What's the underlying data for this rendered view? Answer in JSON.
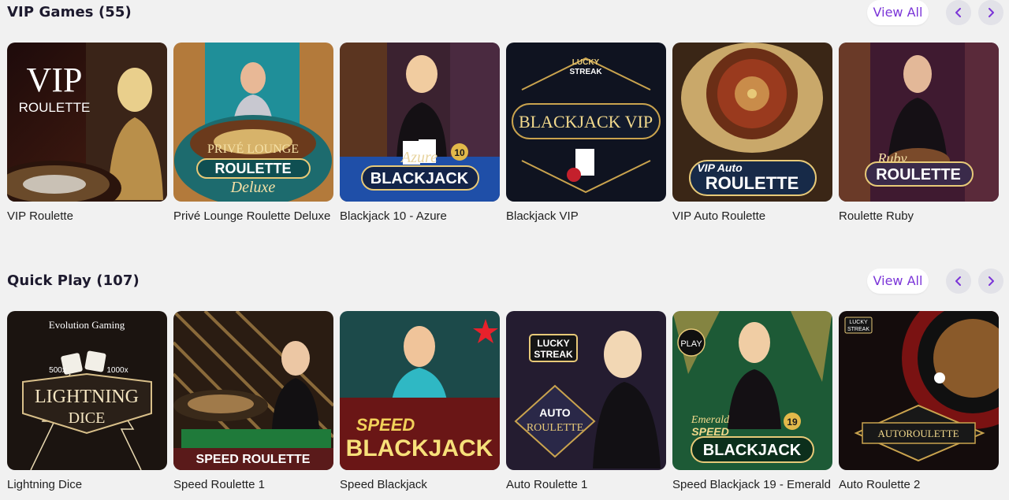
{
  "vip": {
    "title": "VIP Games (55)",
    "view_all": "View All",
    "games": [
      {
        "name": "VIP Roulette",
        "art": [
          "VIP",
          "ROULETTE"
        ]
      },
      {
        "name": "Privé Lounge Roulette Deluxe",
        "art": [
          "PRIVÉ LOUNGE",
          "ROULETTE",
          "Deluxe"
        ]
      },
      {
        "name": "Blackjack 10 - Azure",
        "art": [
          "Azure",
          "BLACKJACK",
          "10"
        ]
      },
      {
        "name": "Blackjack VIP",
        "art": [
          "LUCKY",
          "STREAK",
          "BLACKJACK VIP"
        ]
      },
      {
        "name": "VIP Auto Roulette",
        "art": [
          "VIP Auto",
          "ROULETTE"
        ]
      },
      {
        "name": "Roulette Ruby",
        "art": [
          "Ruby",
          "ROULETTE"
        ]
      }
    ]
  },
  "quick": {
    "title": "Quick Play (107)",
    "view_all": "View All",
    "games": [
      {
        "name": "Lightning Dice",
        "art": [
          "Evolution Gaming",
          "LIGHTNING",
          "DICE",
          "500x",
          "1000x"
        ]
      },
      {
        "name": "Speed Roulette 1",
        "art": [
          "SPEED ROULETTE"
        ]
      },
      {
        "name": "Speed Blackjack",
        "art": [
          "SPEED",
          "BLACKJACK"
        ]
      },
      {
        "name": "Auto Roulette 1",
        "art": [
          "LUCKY",
          "STREAK",
          "AUTO",
          "ROULETTE"
        ]
      },
      {
        "name": "Speed Blackjack 19 - Emerald",
        "art": [
          "PLAY",
          "Emerald",
          "SPEED",
          "BLACKJACK",
          "19"
        ]
      },
      {
        "name": "Auto Roulette 2",
        "art": [
          "LUCKY",
          "STREAK",
          "AUTOROULETTE"
        ]
      }
    ]
  },
  "colors": {
    "accent": "#7b35d8",
    "background": "#f1f1f1",
    "nav_button": "#e2e2e8"
  },
  "icons": {
    "prev": "chevron-left-icon",
    "next": "chevron-right-icon"
  }
}
